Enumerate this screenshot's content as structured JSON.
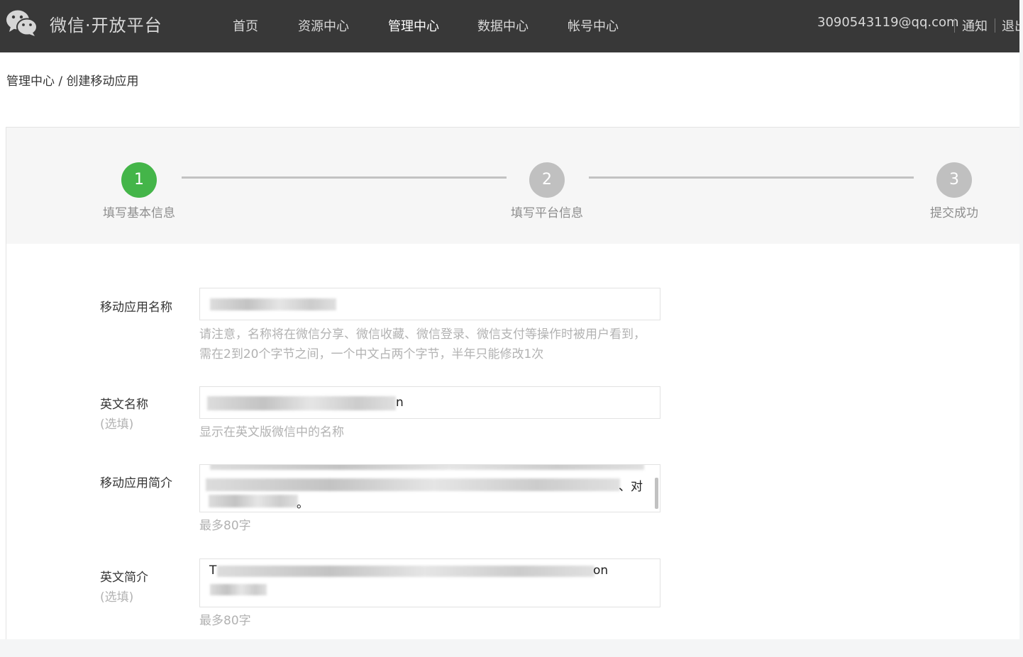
{
  "header": {
    "brand": "微信·开放平台",
    "nav": [
      "首页",
      "资源中心",
      "管理中心",
      "数据中心",
      "帐号中心"
    ],
    "active_nav": "管理中心",
    "account": "3090543119@qq.com",
    "notify": "通知",
    "logout": "退出",
    "logo_icon": "wechat-logo-icon"
  },
  "breadcrumb": "管理中心 / 创建移动应用",
  "steps": [
    {
      "number": "1",
      "label": "填写基本信息",
      "status": "active"
    },
    {
      "number": "2",
      "label": "填写平台信息",
      "status": "pending"
    },
    {
      "number": "3",
      "label": "提交成功",
      "status": "pending"
    }
  ],
  "form": {
    "app_name": {
      "label": "移动应用名称",
      "value": "",
      "hint_line1": "请注意，名称将在微信分享、微信收藏、微信登录、微信支付等操作时被用户看到，",
      "hint_line2": "需在2到20个字节之间，一个中文占两个字节，半年只能修改1次"
    },
    "english_name": {
      "label": "英文名称",
      "optional": "(选填)",
      "value_tail": "n",
      "hint": "显示在英文版微信中的名称"
    },
    "app_intro": {
      "label": "移动应用简介",
      "line2_tail": "、对",
      "line3_tail": "。",
      "hint": "最多80字"
    },
    "english_intro": {
      "label": "英文简介",
      "optional": "(选填)",
      "line1_head": "T",
      "line1_tail": "on",
      "hint": "最多80字"
    }
  },
  "colors": {
    "header_bg": "#383838",
    "step_active": "#44b549",
    "step_pending": "#c0c0c0"
  }
}
